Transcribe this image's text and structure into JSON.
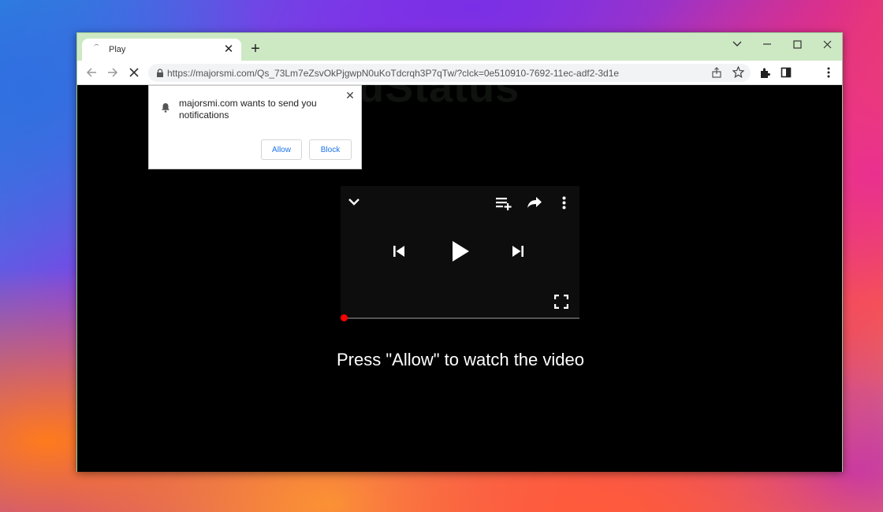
{
  "tab": {
    "title": "Play"
  },
  "address": {
    "url": "https://majorsmi.com/Qs_73Lm7eZsvOkPjgwpN0uKoTdcrqh3P7qTw/?clck=0e510910-7692-11ec-adf2-3d1e"
  },
  "notification": {
    "message": "majorsmi.com wants to send you notifications",
    "allow_label": "Allow",
    "block_label": "Block"
  },
  "watermark": "SecuredStatus",
  "page": {
    "prompt": "Press \"Allow\" to watch the video"
  },
  "player": {
    "progress": 0
  },
  "colors": {
    "titlebar": "#cde9c4",
    "progress": "#ff0000",
    "accent": "#1a73e8"
  }
}
